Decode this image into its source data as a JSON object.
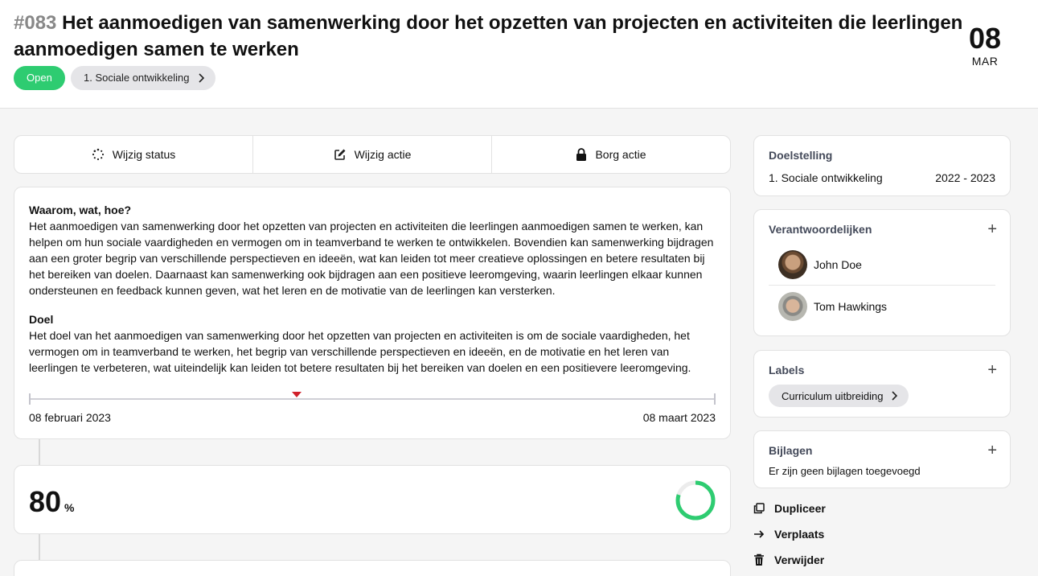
{
  "header": {
    "number": "#083",
    "title": "Het aanmoedigen van samenwerking door het opzetten van projecten en activiteiten die leerlingen aanmoedigen samen te werken",
    "status": "Open",
    "category": "1. Sociale ontwikkeling",
    "date_day": "08",
    "date_month": "MAR"
  },
  "actions": {
    "change_status": "Wijzig status",
    "change_action": "Wijzig actie",
    "secure_action": "Borg actie"
  },
  "description": {
    "why_heading": "Waarom, wat, hoe?",
    "why_text": "Het aanmoedigen van samenwerking door het opzetten van projecten en activiteiten die leerlingen aanmoedigen samen te werken, kan helpen om hun sociale vaardigheden en vermogen om in teamverband te werken te ontwikkelen. Bovendien kan samenwerking bijdragen aan een groter begrip van verschillende perspectieven en ideeën, wat kan leiden tot meer creatieve oplossingen en betere resultaten bij het bereiken van doelen. Daarnaast kan samenwerking ook bijdragen aan een positieve leeromgeving, waarin leerlingen elkaar kunnen ondersteunen en feedback kunnen geven, wat het leren en de motivatie van de leerlingen kan versterken.",
    "goal_heading": "Doel",
    "goal_text": "Het doel van het aanmoedigen van samenwerking door het opzetten van projecten en activiteiten is om de sociale vaardigheden, het vermogen om in teamverband te werken, het begrip van verschillende perspectieven en ideeën, en de motivatie en het leren van leerlingen te verbeteren, wat uiteindelijk kan leiden tot betere resultaten bij het bereiken van doelen en een positievere leeromgeving."
  },
  "timeline": {
    "start": "08 februari 2023",
    "end": "08 maart 2023",
    "current_fraction": 0.39
  },
  "progress": {
    "value": "80",
    "unit": "%",
    "fraction": 0.8,
    "color": "#2ecc71"
  },
  "sidebar": {
    "goal_heading": "Doelstelling",
    "goal_name": "1. Sociale ontwikkeling",
    "goal_period": "2022 - 2023",
    "responsible_heading": "Verantwoordelijken",
    "people": [
      {
        "name": "John Doe"
      },
      {
        "name": "Tom Hawkings"
      }
    ],
    "labels_heading": "Labels",
    "label": "Curriculum uitbreiding",
    "attachments_heading": "Bijlagen",
    "attachments_empty": "Er zijn geen bijlagen toegevoegd",
    "duplicate": "Dupliceer",
    "move": "Verplaats",
    "delete": "Verwijder"
  },
  "colors": {
    "accent_green": "#2ecc71",
    "marker_red": "#d0202a"
  }
}
